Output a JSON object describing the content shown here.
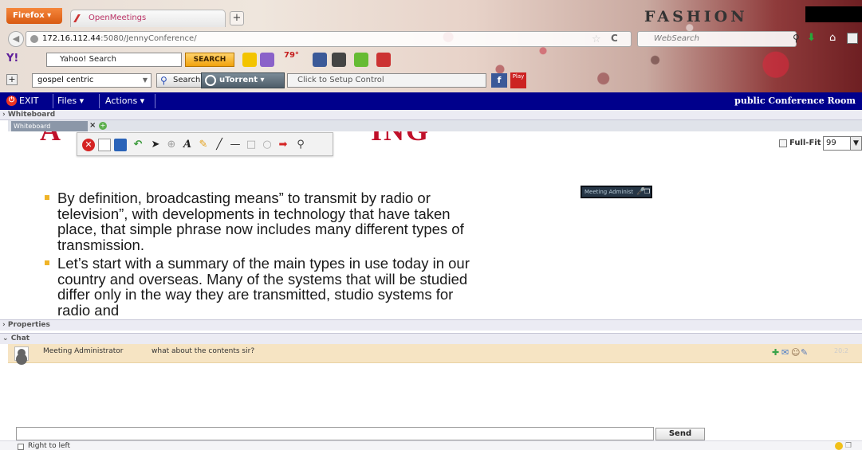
{
  "browser": {
    "firefox_label": "Firefox",
    "tab_title": "OpenMeetings",
    "new_tab_label": "+",
    "fashion_title": "FASHION",
    "url_host": "172.16.112.44",
    "url_rest": ":5080/JennyConference/",
    "search_placeholder": "WebSearch"
  },
  "yahoo_toolbar": {
    "logo": "Y!",
    "search_value": "Yahoo! Search",
    "search_button": "SEARCH",
    "weather": "79°"
  },
  "toolbar3": {
    "search_input_value": "gospel centric",
    "search_button": "Search",
    "utorrent_label": "uTorrent",
    "setup_control_text": "Click to Setup Control",
    "facebook_label": "f",
    "play_label": "Play"
  },
  "app_menu": {
    "exit_label": "EXIT",
    "files_label": "Files ▾",
    "actions_label": "Actions ▾",
    "room_title": "public Conference Room"
  },
  "whiteboard": {
    "header": "Whiteboard",
    "tab_label": "Whiteboard",
    "fullfit_label": "Full-Fit",
    "zoom_value": "99",
    "meeting_badge": "Meeting Administ",
    "slide_heading_left": "A",
    "slide_heading_right": "ING",
    "bullets": [
      "By definition, broadcasting means” to transmit by radio or television”, with developments in technology that have taken place, that simple phrase now includes many different types of transmission.",
      "Let’s start with a summary of the main types in use today in our country and overseas. Many of the systems that will be studied differ only in the way they are transmitted, studio systems for radio and"
    ],
    "tools": [
      "delete-icon",
      "new-page-icon",
      "save-icon",
      "undo-icon",
      "pointer-icon",
      "zoom-icon",
      "text-icon",
      "pen-icon",
      "line-icon",
      "underline-icon",
      "rectangle-icon",
      "ellipse-icon",
      "arrow-icon",
      "clipart-icon"
    ]
  },
  "properties": {
    "header": "Properties"
  },
  "chat": {
    "header": "Chat",
    "messages": [
      {
        "user": "Meeting Administrator",
        "text": "what about the contents sir?",
        "time": "20:2"
      }
    ],
    "send_label": "Send",
    "rtl_label": "Right to left"
  },
  "colors": {
    "menubar_bg": "#00008c",
    "chat_highlight": "#f6e4c3",
    "slide_heading": "#c0102a",
    "bullet": "#f0b428"
  }
}
